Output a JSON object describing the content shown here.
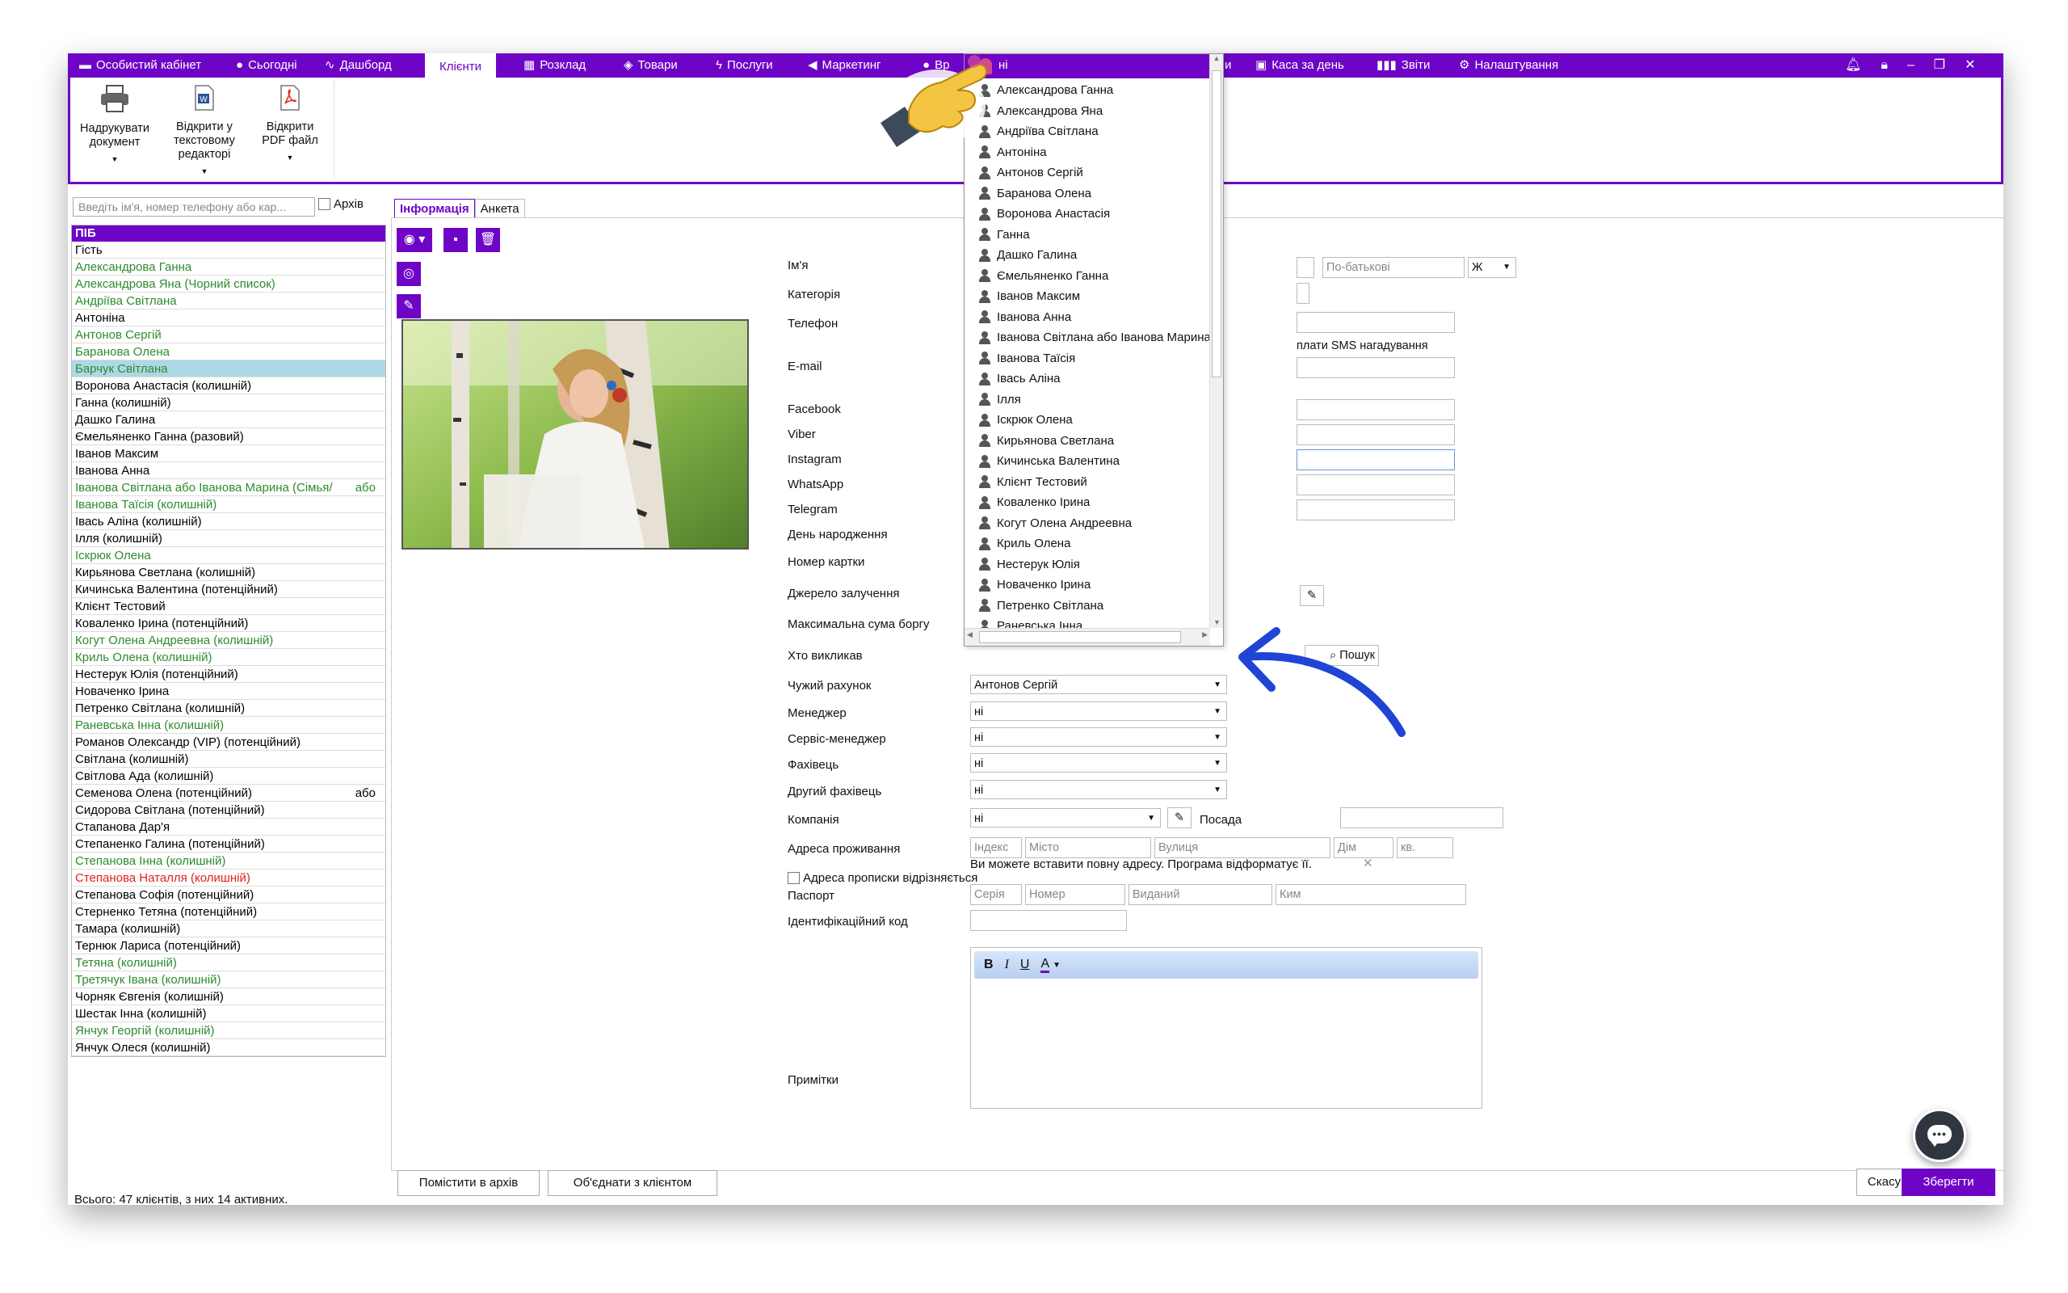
{
  "topbar": {
    "items": [
      {
        "label": "Особистий кабінет",
        "icon": "cabinet-icon"
      },
      {
        "label": "Сьогодні",
        "icon": "sun-icon"
      },
      {
        "label": "Дашборд",
        "icon": "pulse-icon"
      },
      {
        "label": "Клієнти",
        "icon": "",
        "active": true
      },
      {
        "label": "Розклад",
        "icon": "calendar-icon"
      },
      {
        "label": "Товари",
        "icon": "box-icon"
      },
      {
        "label": "Послуги",
        "icon": "bolt-icon"
      },
      {
        "label": "Маркетинг",
        "icon": "megaphone-icon"
      },
      {
        "label": "Каса за день",
        "icon": "calculator-icon"
      },
      {
        "label": "Звіти",
        "icon": "bar-chart-icon"
      },
      {
        "label": "Налаштування",
        "icon": "gear-icon"
      }
    ],
    "partial_left": "Вр",
    "partial_right": "и",
    "window_icons": [
      "bell-icon",
      "lock-icon",
      "minimize-icon",
      "restore-icon",
      "close-icon"
    ]
  },
  "ribbon": {
    "print": "Надрукувати документ",
    "open_text_editor": "Відкрити у текстовому редакторі",
    "open_pdf": "Відкрити PDF файл"
  },
  "left": {
    "search_placeholder": "Введіть ім'я, номер телефону або кар...",
    "archive_label": "Архів",
    "column_header": "ПІБ",
    "clients": [
      {
        "name": "Гість",
        "color": "#000000",
        "extra": ""
      },
      {
        "name": "Александрова Ганна",
        "color": "#2e8b2e",
        "extra": ""
      },
      {
        "name": "Александрова Яна (Чорний список)",
        "color": "#2e8b2e",
        "extra": ""
      },
      {
        "name": "Андріїва Світлана",
        "color": "#2e8b2e",
        "extra": ""
      },
      {
        "name": "Антоніна",
        "color": "#000000",
        "extra": ""
      },
      {
        "name": "Антонов Сергій",
        "color": "#2e8b2e",
        "extra": ""
      },
      {
        "name": "Баранова Олена",
        "color": "#2e8b2e",
        "extra": ""
      },
      {
        "name": "Барчук Світлана",
        "color": "#2e8b2e",
        "extra": "",
        "selected": true
      },
      {
        "name": "Воронова Анастасія (колишній)",
        "color": "#000000",
        "extra": ""
      },
      {
        "name": "Ганна (колишній)",
        "color": "#000000",
        "extra": ""
      },
      {
        "name": "Дашко Галина",
        "color": "#000000",
        "extra": ""
      },
      {
        "name": "Ємельяненко Ганна (разовий)",
        "color": "#000000",
        "extra": ""
      },
      {
        "name": "Іванов Максим",
        "color": "#000000",
        "extra": ""
      },
      {
        "name": "Іванова Анна",
        "color": "#000000",
        "extra": ""
      },
      {
        "name": "Іванова Світлана або Іванова Марина (Сімья/",
        "color": "#2e8b2e",
        "extra": "або"
      },
      {
        "name": "Іванова Таїсія (колишній)",
        "color": "#2e8b2e",
        "extra": ""
      },
      {
        "name": "Івась Аліна (колишній)",
        "color": "#000000",
        "extra": ""
      },
      {
        "name": "Ілля (колишній)",
        "color": "#000000",
        "extra": ""
      },
      {
        "name": "Іскрюк Олена",
        "color": "#2e8b2e",
        "extra": ""
      },
      {
        "name": "Кирьянова Светлана (колишній)",
        "color": "#000000",
        "extra": ""
      },
      {
        "name": "Кичинська Валентина (потенційний)",
        "color": "#000000",
        "extra": ""
      },
      {
        "name": "Клієнт Тестовий",
        "color": "#000000",
        "extra": ""
      },
      {
        "name": "Коваленко Ірина (потенційний)",
        "color": "#000000",
        "extra": ""
      },
      {
        "name": "Когут Олена Андреевна (колишній)",
        "color": "#2e8b2e",
        "extra": ""
      },
      {
        "name": "Криль Олена (колишній)",
        "color": "#2e8b2e",
        "extra": ""
      },
      {
        "name": "Нестерук Юлія (потенційний)",
        "color": "#000000",
        "extra": ""
      },
      {
        "name": "Новаченко Ірина",
        "color": "#000000",
        "extra": ""
      },
      {
        "name": "Петренко Світлана (колишній)",
        "color": "#000000",
        "extra": ""
      },
      {
        "name": "Раневська Інна (колишній)",
        "color": "#2e8b2e",
        "extra": ""
      },
      {
        "name": "Романов Олександр (VIP) (потенційний)",
        "color": "#000000",
        "extra": ""
      },
      {
        "name": "Світлана (колишній)",
        "color": "#000000",
        "extra": ""
      },
      {
        "name": "Світлова Ада (колишній)",
        "color": "#000000",
        "extra": ""
      },
      {
        "name": "Семенова Олена (потенційний)",
        "color": "#000000",
        "extra": "або"
      },
      {
        "name": "Сидорова Світлана (потенційний)",
        "color": "#000000",
        "extra": ""
      },
      {
        "name": "Стапанова Дар'я",
        "color": "#000000",
        "extra": ""
      },
      {
        "name": "Степаненко Галина (потенційний)",
        "color": "#000000",
        "extra": ""
      },
      {
        "name": "Степанова Інна (колишній)",
        "color": "#2e8b2e",
        "extra": ""
      },
      {
        "name": "Степанова Наталля (колишній)",
        "color": "#e02020",
        "extra": ""
      },
      {
        "name": "Степанова Софія (потенційний)",
        "color": "#000000",
        "extra": ""
      },
      {
        "name": "Стерненко Тетяна (потенційний)",
        "color": "#000000",
        "extra": ""
      },
      {
        "name": "Тамара (колишній)",
        "color": "#000000",
        "extra": ""
      },
      {
        "name": "Тернюк Лариса (потенційний)",
        "color": "#000000",
        "extra": ""
      },
      {
        "name": "Тетяна (колишній)",
        "color": "#2e8b2e",
        "extra": ""
      },
      {
        "name": "Третячук Івана (колишній)",
        "color": "#2e8b2e",
        "extra": ""
      },
      {
        "name": "Чорняк Євгенія (колишній)",
        "color": "#000000",
        "extra": ""
      },
      {
        "name": "Шестак Інна (колишній)",
        "color": "#000000",
        "extra": ""
      },
      {
        "name": "Янчук Георгій (колишній)",
        "color": "#2e8b2e",
        "extra": ""
      },
      {
        "name": "Янчук Олеся (колишній)",
        "color": "#000000",
        "extra": ""
      }
    ],
    "total": "Всього: 47 клієнтів, з них 14 активних."
  },
  "tabs": {
    "info": "Інформація",
    "form": "Анкета"
  },
  "form": {
    "labels": {
      "name": "Ім'я",
      "category": "Категорія",
      "phone": "Телефон",
      "email": "E-mail",
      "facebook": "Facebook",
      "viber": "Viber",
      "instagram": "Instagram",
      "whatsapp": "WhatsApp",
      "telegram": "Telegram",
      "birthday": "День народження",
      "card": "Номер картки",
      "source": "Джерело залучення",
      "max_debt": "Максимальна сума боргу",
      "who_called": "Хто викликав",
      "foreign_account": "Чужий рахунок",
      "manager": "Менеджер",
      "service_manager": "Сервіс-менеджер",
      "specialist": "Фахівець",
      "other_specialist": "Другий фахівець",
      "company": "Компанія",
      "position": "Посада",
      "address": "Адреса проживання",
      "reg_address_differs": "Адреса прописки відрізняється",
      "passport": "Паспорт",
      "id_code": "Ідентифікаційний код",
      "notes": "Примітки"
    },
    "patronymic_placeholder": "По-батькові",
    "gender_value": "Ж",
    "sms_text": "плати SMS нагадування",
    "search_button": "Пошук",
    "foreign_account_value": "Антонов Сергій",
    "manager_value": "ні",
    "service_manager_value": "ні",
    "specialist_value": "ні",
    "other_specialist_value": "ні",
    "company_value": "ні",
    "address_placeholders": {
      "index": "Індекс",
      "city": "Місто",
      "street": "Вулиця",
      "house": "Дім",
      "apt": "кв."
    },
    "address_hint": "Ви можете вставити повну адресу. Програма відформатує її.",
    "passport_placeholders": {
      "series": "Серія",
      "number": "Номер",
      "issued": "Виданий",
      "by_whom": "Ким"
    },
    "rte": {
      "bold": "B",
      "italic": "I",
      "underline": "U",
      "color": "A"
    }
  },
  "dropdown": {
    "header_value": "ні",
    "items": [
      "Александрова Ганна",
      "Александрова Яна",
      "Андріїва Світлана",
      "Антоніна",
      "Антонов Сергій",
      "Баранова Олена",
      "Воронова Анастасія",
      "Ганна",
      "Дашко Галина",
      "Ємельяненко Ганна",
      "Іванов Максим",
      "Іванова Анна",
      "Іванова Світлана або Іванова Марина",
      "Іванова Таїсія",
      "Івась Аліна",
      "Ілля",
      "Іскрюк Олена",
      "Кирьянова Светлана",
      "Кичинська Валентина",
      "Клієнт Тестовий",
      "Коваленко Ірина",
      "Когут Олена Андреевна",
      "Криль Олена",
      "Нестерук Юлія",
      "Новаченко Ірина",
      "Петренко Світлана",
      "Раневська Інна"
    ]
  },
  "buttons": {
    "archive": "Помістити в архів",
    "merge": "Об'єднати з клієнтом",
    "cancel": "Скасувати",
    "save": "Зберегти"
  },
  "colors": {
    "accent": "#6E05C6",
    "active_client": "#2e8b2e",
    "blocked_client": "#e02020",
    "selected_row": "#add8e6"
  }
}
